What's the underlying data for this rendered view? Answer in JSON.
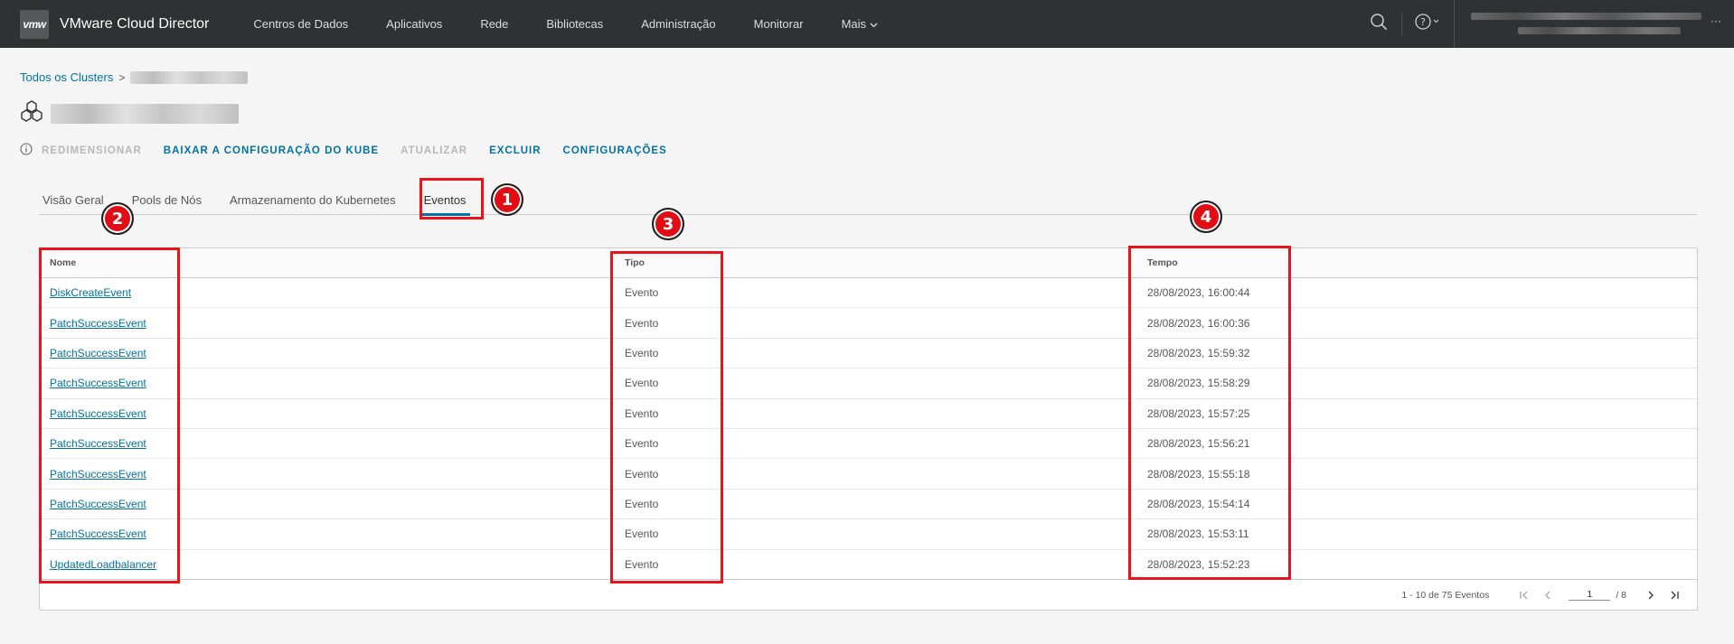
{
  "header": {
    "logo_text": "vmw",
    "app_title": "VMware Cloud Director",
    "nav_items": [
      "Centros de Dados",
      "Aplicativos",
      "Rede",
      "Bibliotecas",
      "Administração",
      "Monitorar"
    ],
    "more_label": "Mais",
    "user_menu_label": "···"
  },
  "breadcrumb": {
    "root_label": "Todos os Clusters",
    "separator": ">"
  },
  "actions": {
    "resize": "REDIMENSIONAR",
    "download_kube_config": "BAIXAR A CONFIGURAÇÃO DO KUBE",
    "update": "ATUALIZAR",
    "delete": "EXCLUIR",
    "settings": "CONFIGURAÇÕES"
  },
  "tabs": [
    {
      "label": "Visão Geral",
      "active": false
    },
    {
      "label": "Pools de Nós",
      "active": false
    },
    {
      "label": "Armazenamento do Kubernetes",
      "active": false
    },
    {
      "label": "Eventos",
      "active": true
    }
  ],
  "table": {
    "columns": [
      "Nome",
      "Tipo",
      "Tempo"
    ],
    "rows": [
      {
        "name": "DiskCreateEvent",
        "type": "Evento",
        "time": "28/08/2023, 16:00:44"
      },
      {
        "name": "PatchSuccessEvent",
        "type": "Evento",
        "time": "28/08/2023, 16:00:36"
      },
      {
        "name": "PatchSuccessEvent",
        "type": "Evento",
        "time": "28/08/2023, 15:59:32"
      },
      {
        "name": "PatchSuccessEvent",
        "type": "Evento",
        "time": "28/08/2023, 15:58:29"
      },
      {
        "name": "PatchSuccessEvent",
        "type": "Evento",
        "time": "28/08/2023, 15:57:25"
      },
      {
        "name": "PatchSuccessEvent",
        "type": "Evento",
        "time": "28/08/2023, 15:56:21"
      },
      {
        "name": "PatchSuccessEvent",
        "type": "Evento",
        "time": "28/08/2023, 15:55:18"
      },
      {
        "name": "PatchSuccessEvent",
        "type": "Evento",
        "time": "28/08/2023, 15:54:14"
      },
      {
        "name": "PatchSuccessEvent",
        "type": "Evento",
        "time": "28/08/2023, 15:53:11"
      },
      {
        "name": "UpdatedLoadbalancer",
        "type": "Evento",
        "time": "28/08/2023, 15:52:23"
      }
    ]
  },
  "pagination": {
    "summary": "1 - 10 de 75 Eventos",
    "current_page": "1",
    "total_pages": "/ 8"
  },
  "annotations": {
    "badge_1": "1",
    "badge_2": "2",
    "badge_3": "3",
    "badge_4": "4",
    "color": "#e8131b"
  },
  "colors": {
    "topbar": "#2f3233",
    "link": "#0072a3",
    "disabled": "#b8b8b8"
  }
}
